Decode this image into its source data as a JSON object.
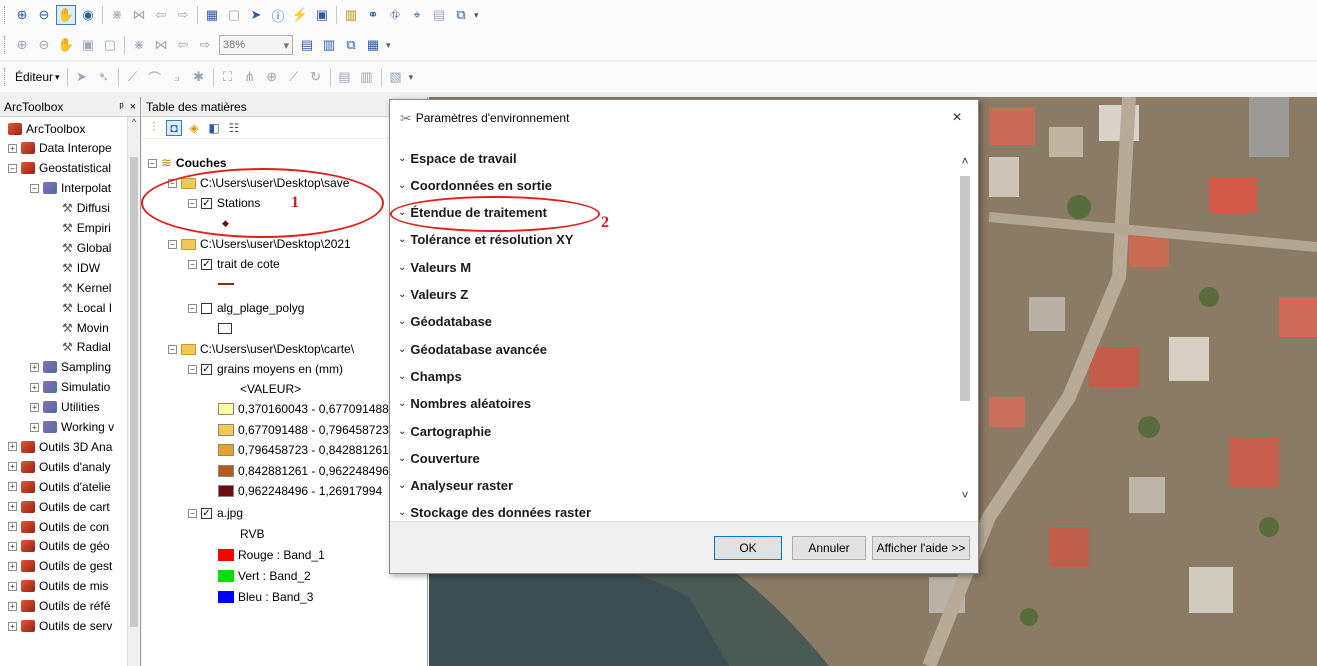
{
  "toolbar": {
    "zoom_value": "38%",
    "editor_label": "Éditeur"
  },
  "arctoolbox": {
    "title": "ArcToolbox",
    "pin_label": "ᵖ",
    "close_label": "×",
    "items": [
      {
        "label": "ArcToolbox",
        "kind": "root"
      },
      {
        "label": "Data Interope",
        "kind": "toolbox"
      },
      {
        "label": "Geostatistical",
        "kind": "toolbox"
      },
      {
        "label": "Interpolat",
        "kind": "toolset"
      },
      {
        "label": "Diffusi",
        "kind": "tool"
      },
      {
        "label": "Empiri",
        "kind": "tool"
      },
      {
        "label": "Global",
        "kind": "tool"
      },
      {
        "label": "IDW",
        "kind": "tool"
      },
      {
        "label": "Kernel",
        "kind": "tool"
      },
      {
        "label": "Local I",
        "kind": "tool"
      },
      {
        "label": "Movin",
        "kind": "tool"
      },
      {
        "label": "Radial",
        "kind": "tool"
      },
      {
        "label": "Sampling",
        "kind": "toolset"
      },
      {
        "label": "Simulatio",
        "kind": "toolset"
      },
      {
        "label": "Utilities",
        "kind": "toolset"
      },
      {
        "label": "Working v",
        "kind": "toolset"
      },
      {
        "label": "Outils 3D Ana",
        "kind": "toolbox"
      },
      {
        "label": "Outils d'analy",
        "kind": "toolbox"
      },
      {
        "label": "Outils d'atelie",
        "kind": "toolbox"
      },
      {
        "label": "Outils de cart",
        "kind": "toolbox"
      },
      {
        "label": "Outils de con",
        "kind": "toolbox"
      },
      {
        "label": "Outils de géo",
        "kind": "toolbox"
      },
      {
        "label": "Outils de gest",
        "kind": "toolbox"
      },
      {
        "label": "Outils de mis",
        "kind": "toolbox"
      },
      {
        "label": "Outils de réfé",
        "kind": "toolbox"
      },
      {
        "label": "Outils de serv",
        "kind": "toolbox"
      }
    ]
  },
  "toc": {
    "title": "Table des matières",
    "root": "Couches",
    "folder1": "C:\\Users\\user\\Desktop\\save",
    "stations": "Stations",
    "folder2": "C:\\Users\\user\\Desktop\\2021",
    "trait": "trait de cote",
    "alg": "alg_plage_polyg",
    "folder3": "C:\\Users\\user\\Desktop\\carte\\",
    "grains": "grains moyens en (mm)",
    "valeur": "<VALEUR>",
    "classes": [
      {
        "label": "0,370160043 - 0,677091488",
        "color": "#ffff99"
      },
      {
        "label": "0,677091488 - 0,796458723",
        "color": "#f2c94c"
      },
      {
        "label": "0,796458723 - 0,842881261",
        "color": "#e8a22a"
      },
      {
        "label": "0,842881261 - 0,962248496",
        "color": "#b65a1a"
      },
      {
        "label": "0,962248496 - 1,26917994",
        "color": "#6b0d0d"
      }
    ],
    "ajpg": "a.jpg",
    "rvb": "RVB",
    "bands": [
      {
        "label": "Rouge :  Band_1",
        "color": "#ff0000"
      },
      {
        "label": "Vert : Band_2",
        "color": "#00e000"
      },
      {
        "label": "Bleu :  Band_3",
        "color": "#0000ff"
      }
    ]
  },
  "dialog": {
    "title": "Paramètres d'environnement",
    "close": "×",
    "items": [
      "Espace de travail",
      "Coordonnées en sortie",
      "Étendue de traitement",
      "Tolérance et résolution XY",
      "Valeurs M",
      "Valeurs Z",
      "Géodatabase",
      "Géodatabase avancée",
      "Champs",
      "Nombres aléatoires",
      "Cartographie",
      "Couverture",
      "Analyseur raster",
      "Stockage des données raster"
    ],
    "ok": "OK",
    "cancel": "Annuler",
    "help": "Afficher l'aide >>"
  },
  "annotations": {
    "one": "1",
    "two": "2"
  }
}
